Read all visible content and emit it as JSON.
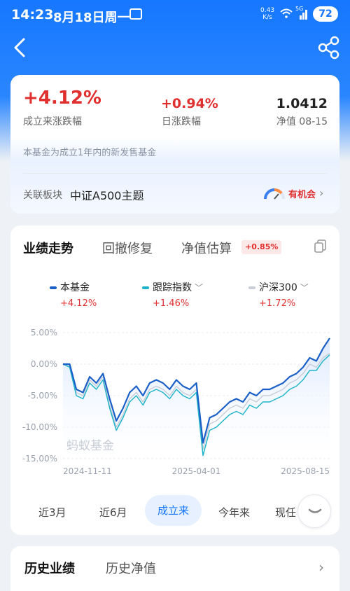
{
  "status": {
    "time": "14:23",
    "date": "8月18日周一",
    "speed_value": "0.43",
    "speed_unit": "K/s",
    "network": "5G",
    "battery": "72"
  },
  "summary": {
    "since_inception_value": "+4.12%",
    "since_inception_label": "成立来涨跌幅",
    "daily_value": "+0.94%",
    "daily_label": "日涨跌幅",
    "nav_value": "1.0412",
    "nav_label": "净值 08-15",
    "tip": "本基金为成立1年内的新发售基金",
    "sector_label": "关联板块",
    "sector_value": "中证A500主题",
    "opportunity": "有机会"
  },
  "tabs": {
    "performance": "业绩走势",
    "drawdown": "回撤修复",
    "estimate": "净值估算",
    "estimate_badge": "+0.85%"
  },
  "legend": [
    {
      "name": "本基金",
      "value": "+4.12%",
      "color": "#1a5fc8"
    },
    {
      "name": "跟踪指数",
      "value": "+1.46%",
      "color": "#1fb5c9"
    },
    {
      "name": "沪深300",
      "value": "+1.72%",
      "color": "#c8cdd6"
    }
  ],
  "watermark": "蚂蚁基金",
  "ranges": {
    "m3": "近3月",
    "m6": "近6月",
    "since": "成立来",
    "ytd": "今年来",
    "current": "现任"
  },
  "history": {
    "performance": "历史业绩",
    "nav": "历史净值"
  },
  "chart_data": {
    "type": "line",
    "y_tick_labels": [
      "5.00%",
      "0.00%",
      "-5.00%",
      "-10.00%",
      "-15.00%"
    ],
    "x_tick_labels": [
      "2024-11-11",
      "2025-04-01",
      "2025-08-15"
    ],
    "ylim": [
      -15,
      5
    ],
    "x": [
      "2024-11-11",
      "2024-11-18",
      "2024-11-25",
      "2024-12-02",
      "2024-12-09",
      "2024-12-16",
      "2024-12-23",
      "2024-12-30",
      "2025-01-06",
      "2025-01-13",
      "2025-01-20",
      "2025-01-27",
      "2025-02-03",
      "2025-02-10",
      "2025-02-17",
      "2025-02-24",
      "2025-03-03",
      "2025-03-10",
      "2025-03-17",
      "2025-03-24",
      "2025-03-31",
      "2025-04-07",
      "2025-04-14",
      "2025-04-21",
      "2025-04-28",
      "2025-05-05",
      "2025-05-12",
      "2025-05-19",
      "2025-05-26",
      "2025-06-02",
      "2025-06-09",
      "2025-06-16",
      "2025-06-23",
      "2025-06-30",
      "2025-07-07",
      "2025-07-14",
      "2025-07-21",
      "2025-07-28",
      "2025-08-04",
      "2025-08-11",
      "2025-08-15"
    ],
    "series": [
      {
        "name": "本基金",
        "color": "#1a5fc8",
        "values": [
          0.0,
          0.0,
          -4.0,
          -4.5,
          -2.0,
          -3.0,
          -1.5,
          -5.5,
          -9.0,
          -7.0,
          -4.5,
          -3.5,
          -5.0,
          -3.0,
          -2.5,
          -3.0,
          -4.0,
          -2.5,
          -3.5,
          -4.0,
          -3.0,
          -12.5,
          -8.5,
          -8.0,
          -7.0,
          -6.0,
          -5.5,
          -6.0,
          -4.5,
          -5.0,
          -4.0,
          -4.0,
          -3.5,
          -3.0,
          -2.0,
          -1.5,
          -0.5,
          1.0,
          0.5,
          2.5,
          4.12
        ]
      },
      {
        "name": "跟踪指数",
        "color": "#1fb5c9",
        "values": [
          0.0,
          -0.5,
          -5.0,
          -5.5,
          -3.0,
          -4.0,
          -2.5,
          -7.0,
          -10.5,
          -8.5,
          -6.0,
          -5.0,
          -6.5,
          -4.5,
          -4.0,
          -4.5,
          -5.5,
          -4.0,
          -5.0,
          -5.5,
          -4.5,
          -14.5,
          -10.5,
          -10.0,
          -9.0,
          -8.0,
          -7.5,
          -8.0,
          -6.5,
          -7.0,
          -6.0,
          -6.0,
          -5.5,
          -5.0,
          -4.0,
          -3.5,
          -2.5,
          -1.0,
          -1.0,
          0.5,
          1.46
        ]
      },
      {
        "name": "沪深300",
        "color": "#c8cdd6",
        "values": [
          0.0,
          -0.3,
          -4.5,
          -5.0,
          -2.5,
          -3.5,
          -2.0,
          -6.5,
          -10.0,
          -8.0,
          -5.5,
          -4.5,
          -6.0,
          -4.0,
          -3.5,
          -4.0,
          -5.0,
          -3.5,
          -4.5,
          -5.0,
          -4.0,
          -13.5,
          -9.5,
          -9.0,
          -8.0,
          -7.0,
          -6.5,
          -7.0,
          -5.5,
          -6.0,
          -5.0,
          -5.0,
          -4.5,
          -4.0,
          -3.0,
          -2.5,
          -1.5,
          0.0,
          -0.5,
          1.0,
          1.72
        ]
      }
    ]
  }
}
